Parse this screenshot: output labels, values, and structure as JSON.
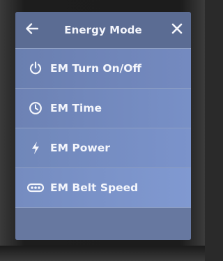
{
  "header": {
    "title": "Energy Mode",
    "back_icon": "arrow-left-icon",
    "close_icon": "close-icon"
  },
  "menu": {
    "items": [
      {
        "label": "EM Turn On/Off",
        "icon": "power-icon"
      },
      {
        "label": "EM Time",
        "icon": "clock-icon"
      },
      {
        "label": "EM Power",
        "icon": "lightning-icon"
      },
      {
        "label": "EM Belt Speed",
        "icon": "belt-speed-icon"
      }
    ]
  },
  "colors": {
    "screen_bg": "#5d6e94",
    "item_text": "#f4f6fc",
    "divider": "#8e9fc3"
  }
}
